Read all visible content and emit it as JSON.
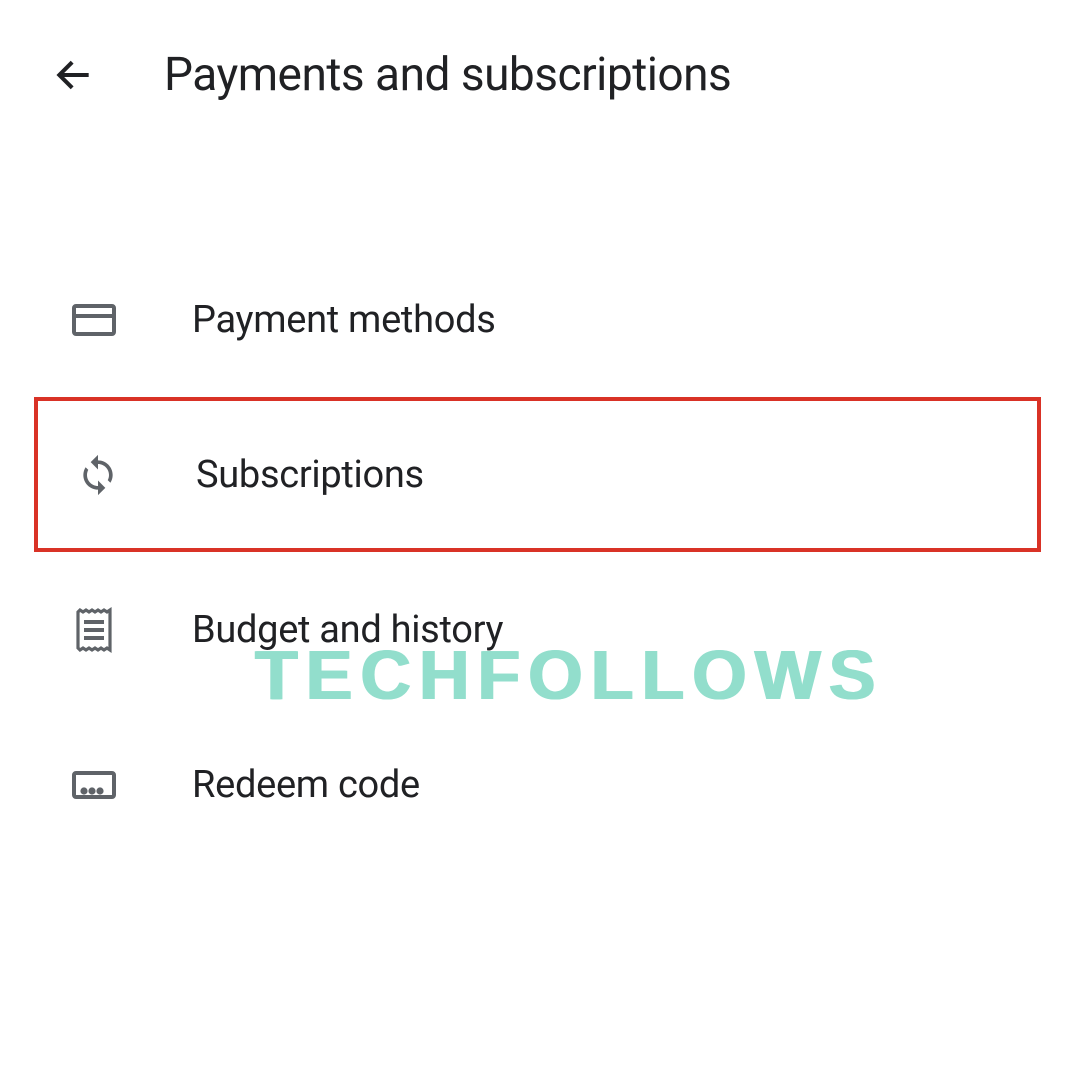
{
  "header": {
    "title": "Payments and subscriptions"
  },
  "menu": {
    "items": [
      {
        "label": "Payment methods"
      },
      {
        "label": "Subscriptions"
      },
      {
        "label": "Budget and history"
      },
      {
        "label": "Redeem code"
      }
    ]
  },
  "watermark": {
    "text": "TECHFOLLOWS"
  }
}
